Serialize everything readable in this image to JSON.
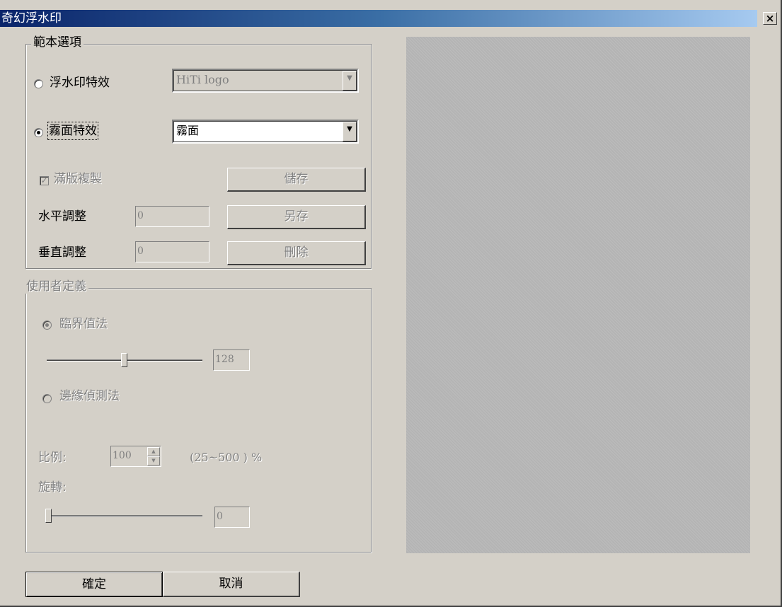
{
  "window": {
    "title": "奇幻浮水印",
    "close_glyph": "×"
  },
  "template_group": {
    "legend": "範本選項",
    "watermark_effect_label": "浮水印特效",
    "watermark_effect_value": "HiTi logo",
    "watermark_effect_selected": false,
    "frost_effect_label": "霧面特效",
    "frost_effect_value": "霧面",
    "frost_effect_selected": true,
    "tile_copy_label": "滿版複製",
    "tile_copy_checked": true,
    "save_label": "儲存",
    "save_as_label": "另存",
    "delete_label": "刪除",
    "horizontal_label": "水平調整",
    "horizontal_value": "0",
    "vertical_label": "垂直調整",
    "vertical_value": "0"
  },
  "user_group": {
    "legend": "使用者定義",
    "threshold_label": "臨界值法",
    "threshold_selected": true,
    "threshold_value": "128",
    "threshold_slider": 0.5,
    "edge_label": "邊緣偵測法",
    "edge_selected": false,
    "scale_label": "比例:",
    "scale_value": "100",
    "scale_range": "(25~500 ) %",
    "rotate_label": "旋轉:",
    "rotate_value": "0",
    "rotate_slider": 0
  },
  "footer": {
    "ok_label": "確定",
    "cancel_label": "取消"
  },
  "colors": {
    "dialog_bg": "#d4d0c8",
    "title_gradient_start": "#0a246a",
    "preview_bg": "#b4b4b4",
    "disabled_text": "#808080"
  },
  "icons": {
    "close": "close-icon",
    "dropdown": "chevron-down-icon",
    "spin_up": "spin-up-icon",
    "spin_down": "spin-down-icon"
  }
}
